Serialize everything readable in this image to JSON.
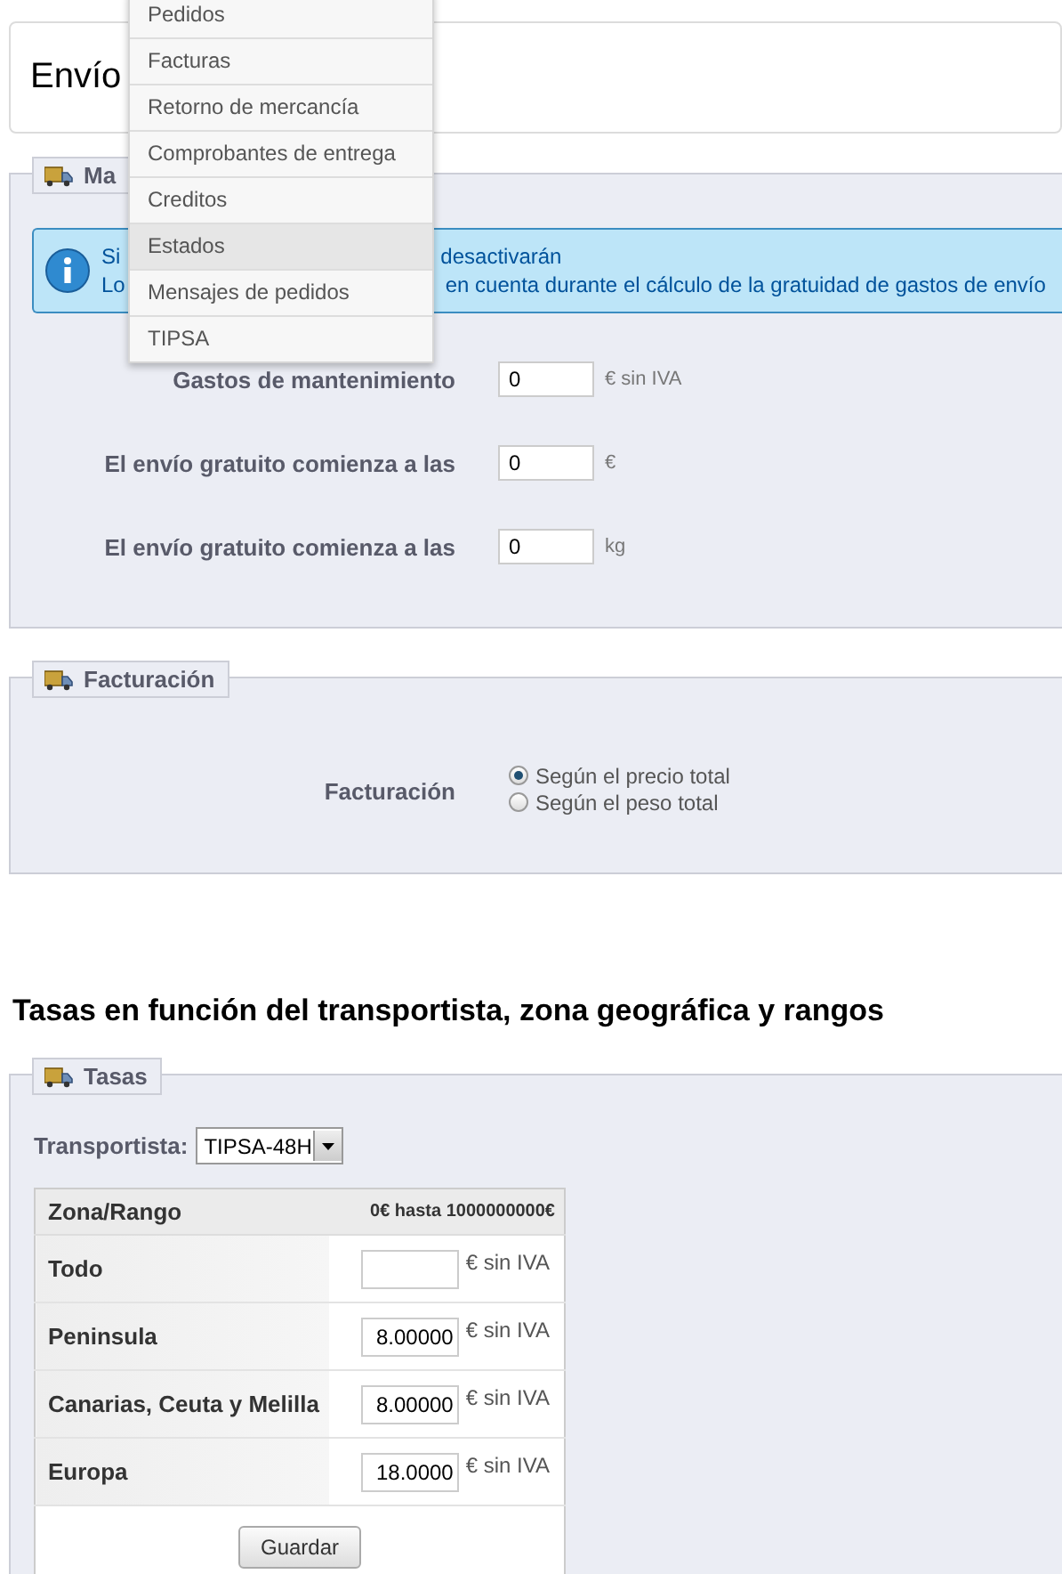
{
  "header": {
    "title": "Envío"
  },
  "menu": {
    "items": [
      {
        "label": "Pedidos",
        "selected": false
      },
      {
        "label": "Facturas",
        "selected": false
      },
      {
        "label": "Retorno de mercancía",
        "selected": false
      },
      {
        "label": "Comprobantes de entrega",
        "selected": false
      },
      {
        "label": "Creditos",
        "selected": false
      },
      {
        "label": "Estados",
        "selected": true
      },
      {
        "label": "Mensajes de pedidos",
        "selected": false
      },
      {
        "label": "TIPSA",
        "selected": false
      }
    ]
  },
  "handling": {
    "legend": "Ma",
    "info_lines": [
      {
        "start": "Si",
        "end": "desactivarán"
      },
      {
        "start": "Lo",
        "end": "en cuenta durante el cálculo de la gratuidad de gastos de envío"
      }
    ],
    "fields": [
      {
        "label": "Gastos de mantenimiento",
        "value": "0",
        "unit": "€ sin IVA"
      },
      {
        "label": "El envío gratuito comienza a las",
        "value": "0",
        "unit": "€"
      },
      {
        "label": "El envío gratuito comienza a las",
        "value": "0",
        "unit": "kg"
      }
    ]
  },
  "billing": {
    "legend": "Facturación",
    "label": "Facturación",
    "options": [
      {
        "label": "Según el precio total",
        "selected": true
      },
      {
        "label": "Según el peso total",
        "selected": false
      }
    ]
  },
  "rates": {
    "heading": "Tasas en función del transportista, zona geográfica y rangos",
    "legend": "Tasas",
    "carrier_label": "Transportista:",
    "carrier": "TIPSA-48H",
    "columns": [
      "Zona/Rango",
      "0€ hasta 1000000000€"
    ],
    "rows": [
      {
        "zone": "Todo",
        "unit": "€ sin IVA"
      },
      {
        "zone": "Peninsula",
        "value": "8.00000",
        "unit": "€ sin IVA"
      },
      {
        "zone": "Canarias, Ceuta y Melilla",
        "value": "8.00000",
        "unit": "€ sin IVA"
      },
      {
        "zone": "Europa",
        "value": "18.0000",
        "unit": "€ sin IVA"
      }
    ],
    "save": "Guardar"
  }
}
